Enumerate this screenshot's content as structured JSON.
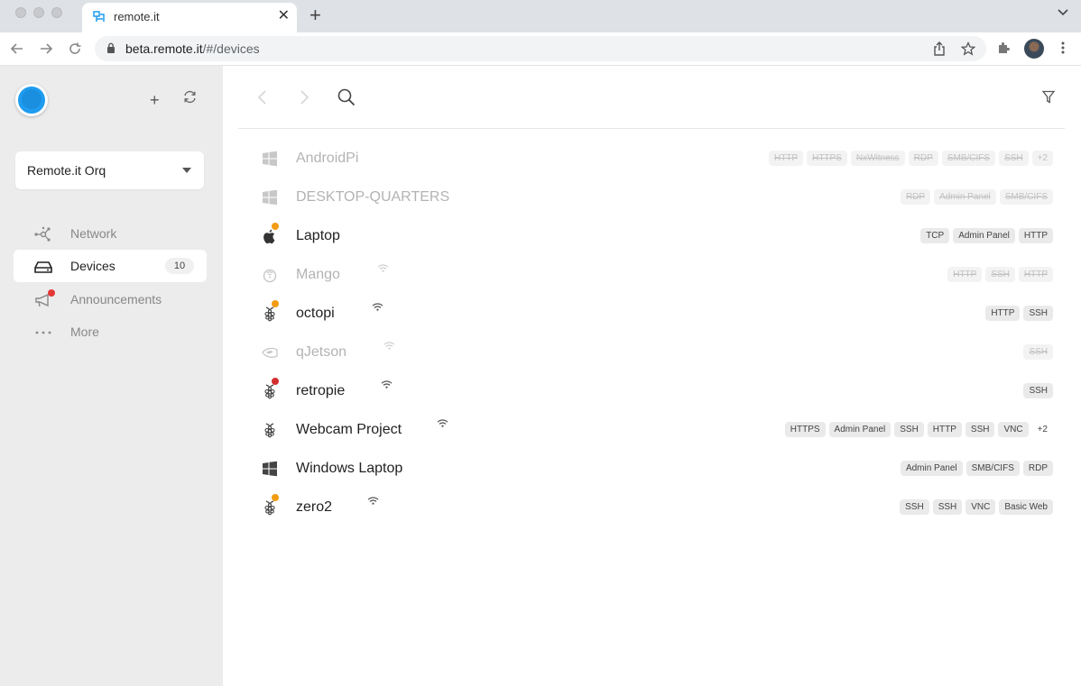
{
  "browser": {
    "tab_title": "remote.it",
    "url_host": "beta.remote.it",
    "url_path": "/#/devices"
  },
  "sidebar": {
    "org": "Remote.it Orq",
    "nav": [
      {
        "label": "Network",
        "icon": "network-icon"
      },
      {
        "label": "Devices",
        "icon": "devices-icon",
        "count": "10",
        "active": true
      },
      {
        "label": "Announcements",
        "icon": "megaphone-icon",
        "badge": true
      },
      {
        "label": "More",
        "icon": "more-icon"
      }
    ]
  },
  "colors": {
    "accent": "#1f9cf0",
    "status_orange": "#f39c12",
    "status_red": "#d32f2f"
  },
  "devices": [
    {
      "name": "AndroidPi",
      "icon": "windows-icon",
      "online": false,
      "wifi": false,
      "services": [
        "HTTP",
        "HTTPS",
        "NxWitness",
        "RDP",
        "SMB/CIFS",
        "SSH"
      ],
      "more": "+2"
    },
    {
      "name": "DESKTOP-QUARTERS",
      "icon": "windows-icon",
      "online": false,
      "wifi": false,
      "services": [
        "RDP",
        "Admin Panel",
        "SMB/CIFS"
      ]
    },
    {
      "name": "Laptop",
      "icon": "apple-icon",
      "online": true,
      "status": "orange",
      "wifi": false,
      "services": [
        "TCP",
        "Admin Panel",
        "HTTP"
      ]
    },
    {
      "name": "Mango",
      "icon": "router-icon",
      "online": false,
      "wifi": true,
      "services": [
        "HTTP",
        "SSH",
        "HTTP"
      ]
    },
    {
      "name": "octopi",
      "icon": "raspberry-icon",
      "online": true,
      "status": "orange",
      "wifi": true,
      "services": [
        "HTTP",
        "SSH"
      ]
    },
    {
      "name": "qJetson",
      "icon": "nvidia-icon",
      "online": false,
      "wifi": true,
      "services": [
        "SSH"
      ]
    },
    {
      "name": "retropie",
      "icon": "raspberry-icon",
      "online": true,
      "status": "red",
      "wifi": true,
      "services": [
        "SSH"
      ]
    },
    {
      "name": "Webcam Project",
      "icon": "raspberry-icon",
      "online": true,
      "wifi": true,
      "services": [
        "HTTPS",
        "Admin Panel",
        "SSH",
        "HTTP",
        "SSH",
        "VNC"
      ],
      "more": "+2"
    },
    {
      "name": "Windows Laptop",
      "icon": "windows-icon",
      "online": true,
      "wifi": false,
      "services": [
        "Admin Panel",
        "SMB/CIFS",
        "RDP"
      ]
    },
    {
      "name": "zero2",
      "icon": "raspberry-icon",
      "online": true,
      "status": "orange",
      "wifi": true,
      "services": [
        "SSH",
        "SSH",
        "VNC",
        "Basic Web"
      ]
    }
  ]
}
